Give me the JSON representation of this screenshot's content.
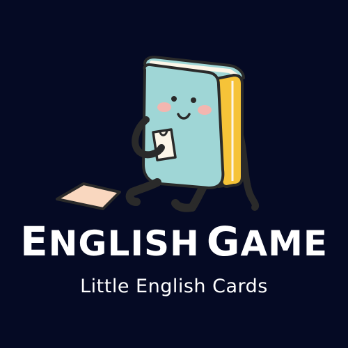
{
  "logo": {
    "title_word_1": "English",
    "title_word_2": "Game",
    "subtitle": "Little English Cards"
  },
  "colors": {
    "background": "#050a24",
    "book_cover": "#9fd6d6",
    "book_spine": "#f6c338",
    "page_edge": "#fdf6e8",
    "card": "#f9d7bf",
    "outline": "#2a2a2a",
    "text": "#ffffff"
  },
  "icons": {
    "mascot": "book-mascot-icon",
    "card": "flashcard-icon"
  }
}
